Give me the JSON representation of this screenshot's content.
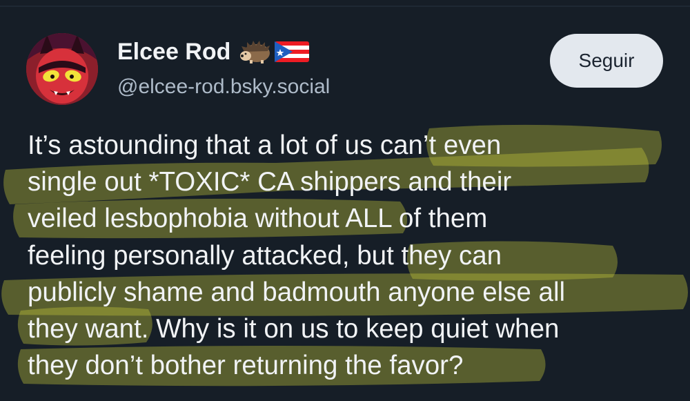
{
  "post": {
    "author": {
      "display_name": "Elcee Rod",
      "handle": "@elcee-rod.bsky.social",
      "name_icons": [
        "hedgehog-icon",
        "puerto-rico-flag-icon"
      ]
    },
    "follow_label": "Seguir",
    "text_lines": [
      "It’s astounding that a lot of us can’t even",
      "single out *TOXIC* CA shippers and their",
      "veiled lesbophobia without ALL of them",
      "feeling personally attacked, but they can",
      "publicly shame and badmouth anyone else all",
      "they want. Why is it on us to keep quiet when",
      "they don’t bother returning the favor?"
    ]
  },
  "colors": {
    "background": "#161e27",
    "text": "#f1f3f5",
    "handle": "#aebbc9",
    "button_bg": "#e3e8ee",
    "button_text": "#1b2430",
    "highlighter": "#c4c83a"
  }
}
